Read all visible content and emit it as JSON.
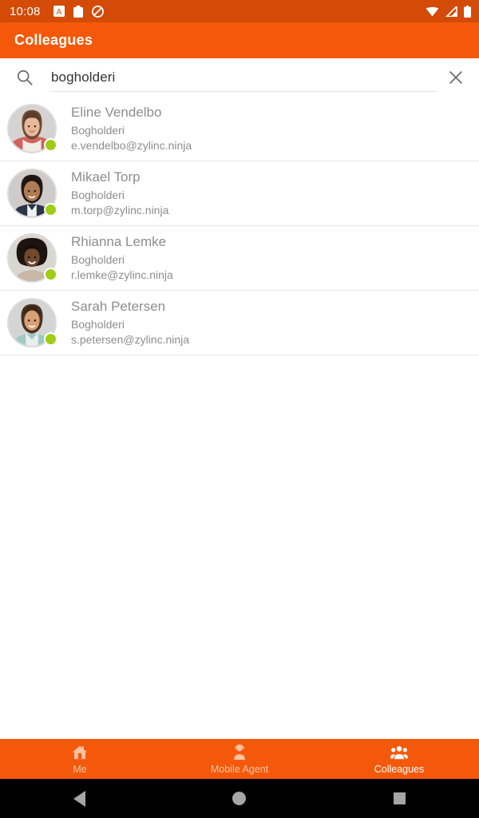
{
  "status_bar": {
    "time": "10:08",
    "left_icons": [
      "alarm-icon",
      "battery-saver-icon",
      "do-not-disturb-icon"
    ],
    "right_icons": [
      "wifi-icon",
      "cellular-signal-icon",
      "battery-icon"
    ],
    "background_color": "#d44a07"
  },
  "app_bar": {
    "title": "Colleagues",
    "background_color": "#f4590b",
    "text_color": "#ffffff"
  },
  "search": {
    "value": "bogholderi",
    "placeholder": "Search",
    "search_icon": "search-icon",
    "clear_icon": "close-icon"
  },
  "contacts": [
    {
      "name": "Eline Vendelbo",
      "role": "Bogholderi",
      "email": "e.vendelbo@zylinc.ninja",
      "presence": "available",
      "presence_color": "#9fcc15"
    },
    {
      "name": "Mikael Torp",
      "role": "Bogholderi",
      "email": "m.torp@zylinc.ninja",
      "presence": "available",
      "presence_color": "#9fcc15"
    },
    {
      "name": "Rhianna Lemke",
      "role": "Bogholderi",
      "email": "r.lemke@zylinc.ninja",
      "presence": "available",
      "presence_color": "#9fcc15"
    },
    {
      "name": "Sarah Petersen",
      "role": "Bogholderi",
      "email": "s.petersen@zylinc.ninja",
      "presence": "available",
      "presence_color": "#9fcc15"
    }
  ],
  "bottom_nav": {
    "items": [
      {
        "label": "Me",
        "icon": "home-icon",
        "active": false
      },
      {
        "label": "Mobile Agent",
        "icon": "person-agent-icon",
        "active": false
      },
      {
        "label": "Colleagues",
        "icon": "people-group-icon",
        "active": true
      }
    ],
    "active_color": "#ffffff",
    "inactive_color": "#ffc3a3"
  },
  "system_nav": {
    "back": "back-triangle-icon",
    "home": "home-circle-icon",
    "recents": "recents-square-icon"
  }
}
